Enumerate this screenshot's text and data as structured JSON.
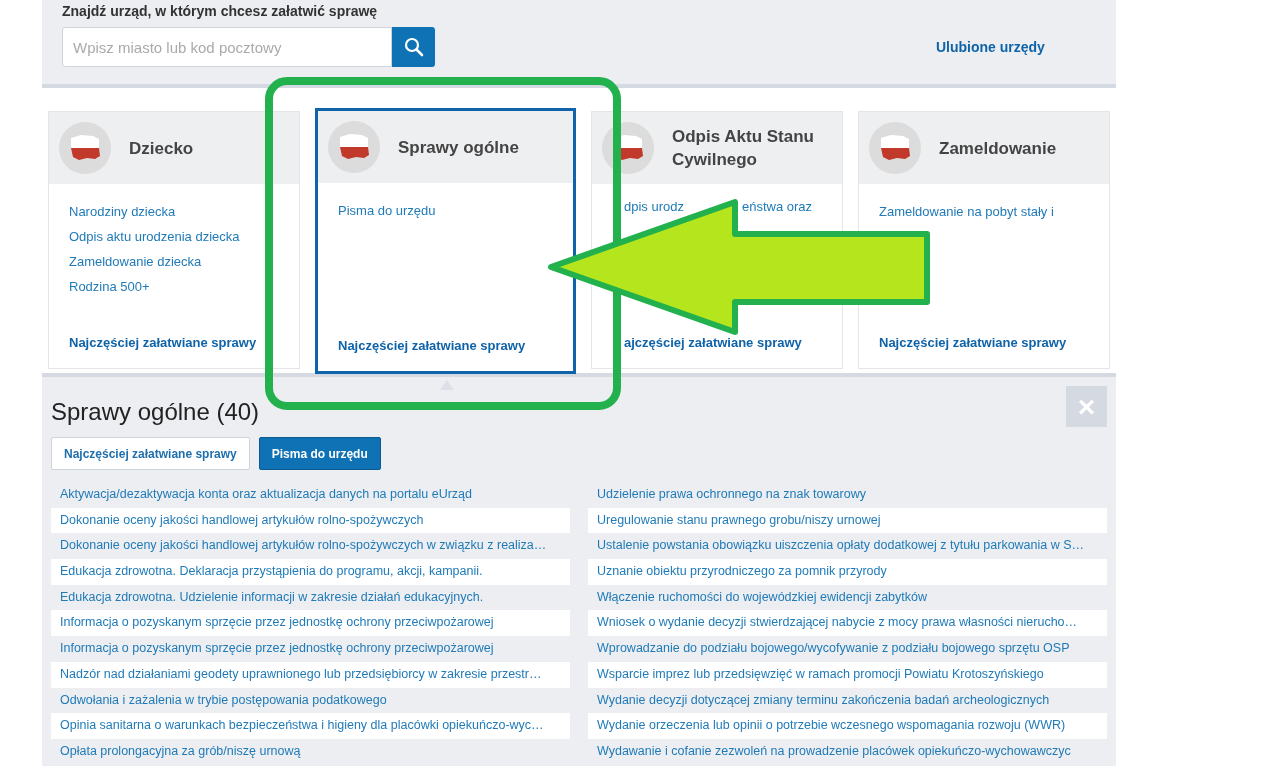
{
  "search": {
    "heading": "Znajdź urząd, w którym chcesz załatwić sprawę",
    "placeholder": "Wpisz miasto lub kod pocztowy",
    "favorites_link": "Ulubione urzędy"
  },
  "categories": [
    {
      "title": "Dziecko",
      "selected": false,
      "links": [
        "Narodziny dziecka",
        "Odpis aktu urodzenia dziecka",
        "Zameldowanie dziecka",
        "Rodzina 500+"
      ],
      "footer_link": "Najczęściej załatwiane sprawy"
    },
    {
      "title": "Sprawy ogólne",
      "selected": true,
      "links": [
        "Pisma do urzędu"
      ],
      "footer_link": "Najczęściej załatwiane sprawy"
    },
    {
      "title": "Odpis Aktu Stanu Cywilnego",
      "selected": false,
      "fragments": [
        "dpis urodz",
        "eństwa oraz"
      ],
      "footer_link": "ajczęściej załatwiane sprawy"
    },
    {
      "title": "Zameldowanie",
      "selected": false,
      "links": [
        "Zameldowanie na pobyt stały i"
      ],
      "footer_link": "Najczęściej załatwiane sprawy"
    }
  ],
  "panel": {
    "title": "Sprawy ogólne (40)",
    "close": "×",
    "tabs": [
      {
        "label": "Najczęściej załatwiane sprawy",
        "selected": false
      },
      {
        "label": "Pisma do urzędu",
        "selected": true
      }
    ],
    "left_items": [
      "Aktywacja/dezaktywacja konta oraz aktualizacja danych na portalu eUrząd",
      "Dokonanie oceny jakości handlowej artykułów rolno-spożywczych",
      "Dokonanie oceny jakości handlowej artykułów rolno-spożywczych w związku z realiza…",
      "Edukacja zdrowotna. Deklaracja przystąpienia do programu, akcji, kampanii.",
      "Edukacja zdrowotna. Udzielenie informacji w zakresie działań edukacyjnych.",
      "Informacja o pozyskanym sprzęcie przez jednostkę ochrony przeciwpożarowej",
      "Informacja o pozyskanym sprzęcie przez jednostkę ochrony przeciwpożarowej",
      "Nadzór nad działaniami geodety uprawnionego lub przedsiębiorcy w zakresie przestr…",
      "Odwołania i zażalenia w trybie postępowania podatkowego",
      "Opinia sanitarna o warunkach bezpieczeństwa i higieny dla placówki opiekuńczo-wyc…",
      "Opłata prolongacyjna za grób/niszę urnową"
    ],
    "right_items": [
      "Udzielenie prawa ochronnego na znak towarowy",
      "Uregulowanie stanu prawnego grobu/niszy urnowej",
      "Ustalenie powstania obowiązku uiszczenia opłaty dodatkowej z tytułu parkowania w S…",
      "Uznanie obiektu przyrodniczego za pomnik przyrody",
      "Włączenie ruchomości do wojewódzkiej ewidencji zabytków",
      "Wniosek o wydanie decyzji stwierdzającej nabycie z mocy prawa własności nierucho…",
      "Wprowadzanie do podziału bojowego/wycofywanie z podziału bojowego sprzętu OSP",
      "Wsparcie imprez lub przedsięwzięć w ramach promocji Powiatu Krotoszyńskiego",
      "Wydanie decyzji dotyczącej zmiany terminu zakończenia badań archeologicznych",
      "Wydanie orzeczenia lub opinii o potrzebie wczesnego wspomagania rozwoju (WWR)",
      "Wydawanie i cofanie zezwoleń na prowadzenie placówek opiekuńczo-wychowawczyc"
    ]
  }
}
